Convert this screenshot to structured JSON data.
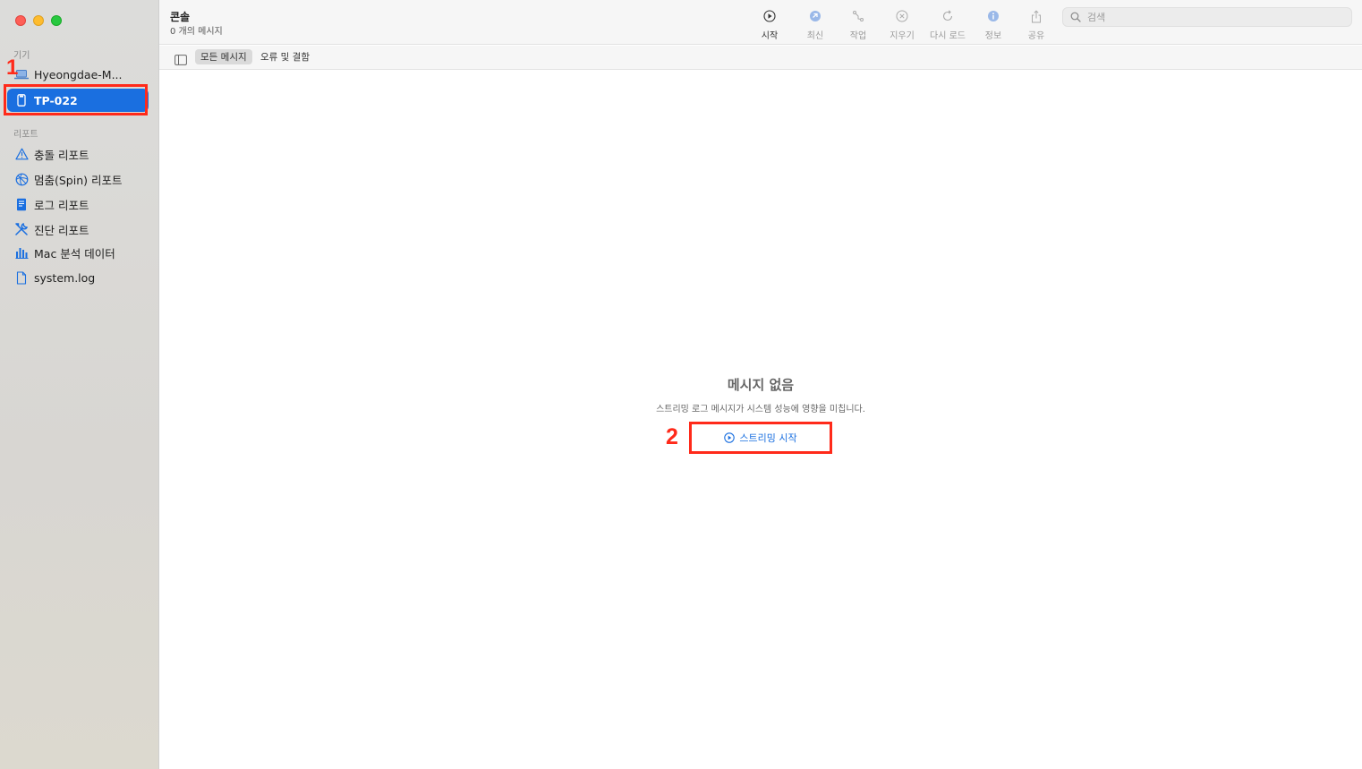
{
  "window": {
    "traffic_lights": [
      "close",
      "minimize",
      "zoom"
    ]
  },
  "sidebar": {
    "devices_label": "기기",
    "devices": [
      {
        "label": "Hyeongdae-M...",
        "icon": "laptop-icon"
      },
      {
        "label": "TP-022",
        "icon": "phone-icon",
        "selected": true
      }
    ],
    "reports_label": "리포트",
    "reports": [
      {
        "label": "충돌 리포트",
        "icon": "warning-icon"
      },
      {
        "label": "멈춤(Spin) 리포트",
        "icon": "spin-icon"
      },
      {
        "label": "로그 리포트",
        "icon": "log-doc-icon"
      },
      {
        "label": "진단 리포트",
        "icon": "tools-icon"
      },
      {
        "label": "Mac 분석 데이터",
        "icon": "chart-icon"
      },
      {
        "label": "system.log",
        "icon": "file-icon"
      }
    ]
  },
  "toolbar": {
    "title": "콘솔",
    "subtitle": "0 개의 메시지",
    "buttons": [
      {
        "label": "시작",
        "icon": "play-circle-icon",
        "enabled": true
      },
      {
        "label": "최신",
        "icon": "arrow-up-circle-icon",
        "enabled": false
      },
      {
        "label": "작업",
        "icon": "activity-icon",
        "enabled": false
      },
      {
        "label": "지우기",
        "icon": "clear-icon",
        "enabled": false
      },
      {
        "label": "다시 로드",
        "icon": "reload-icon",
        "enabled": false
      },
      {
        "label": "정보",
        "icon": "info-icon",
        "enabled": false
      },
      {
        "label": "공유",
        "icon": "share-icon",
        "enabled": false
      }
    ],
    "search_placeholder": "검색"
  },
  "filters": {
    "all": "모든 메시지",
    "errors": "오류 및 결함"
  },
  "empty": {
    "title": "메시지 없음",
    "subtitle": "스트리밍 로그 메시지가 시스템 성능에 영향을 미칩니다.",
    "button": "스트리밍 시작"
  },
  "annotations": {
    "first": "1",
    "second": "2"
  },
  "colors": {
    "accent": "#1a6fe0",
    "annotation": "#ff2a1a"
  }
}
